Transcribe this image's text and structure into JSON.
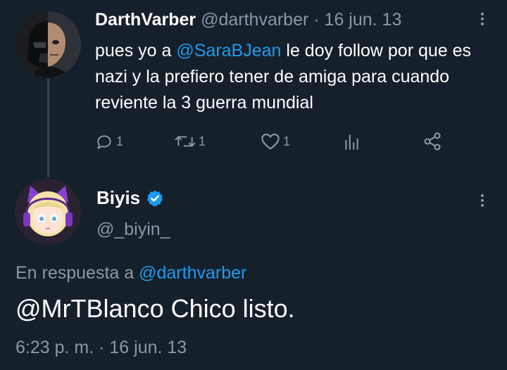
{
  "parent_tweet": {
    "display_name": "DarthVarber",
    "handle": "@darthvarber",
    "separator": "·",
    "date": "16 jun. 13",
    "text_before": "pues yo a ",
    "mention": "@SaraBJean",
    "text_after": " le doy follow por que es nazi y la prefiero tener de amiga para cuando reviente la 3 guerra mundial",
    "actions": {
      "reply_icon": "reply-icon",
      "reply_count": "1",
      "retweet_icon": "retweet-icon",
      "retweet_count": "1",
      "like_icon": "heart-icon",
      "like_count": "1",
      "analytics_icon": "analytics-icon",
      "share_icon": "share-icon"
    }
  },
  "reply_tweet": {
    "display_name": "Biyis",
    "verified_icon": "verified-badge-icon",
    "handle": "@_biyin_",
    "reply_prefix": "En respuesta a ",
    "reply_to_handle": "@darthvarber",
    "body": "@MrTBlanco Chico listo.",
    "timestamp": "6:23 p. m. · 16 jun. 13"
  },
  "colors": {
    "background": "#15202b",
    "text": "#ffffff",
    "muted": "#8b98a5",
    "accent": "#1d9bf0"
  }
}
